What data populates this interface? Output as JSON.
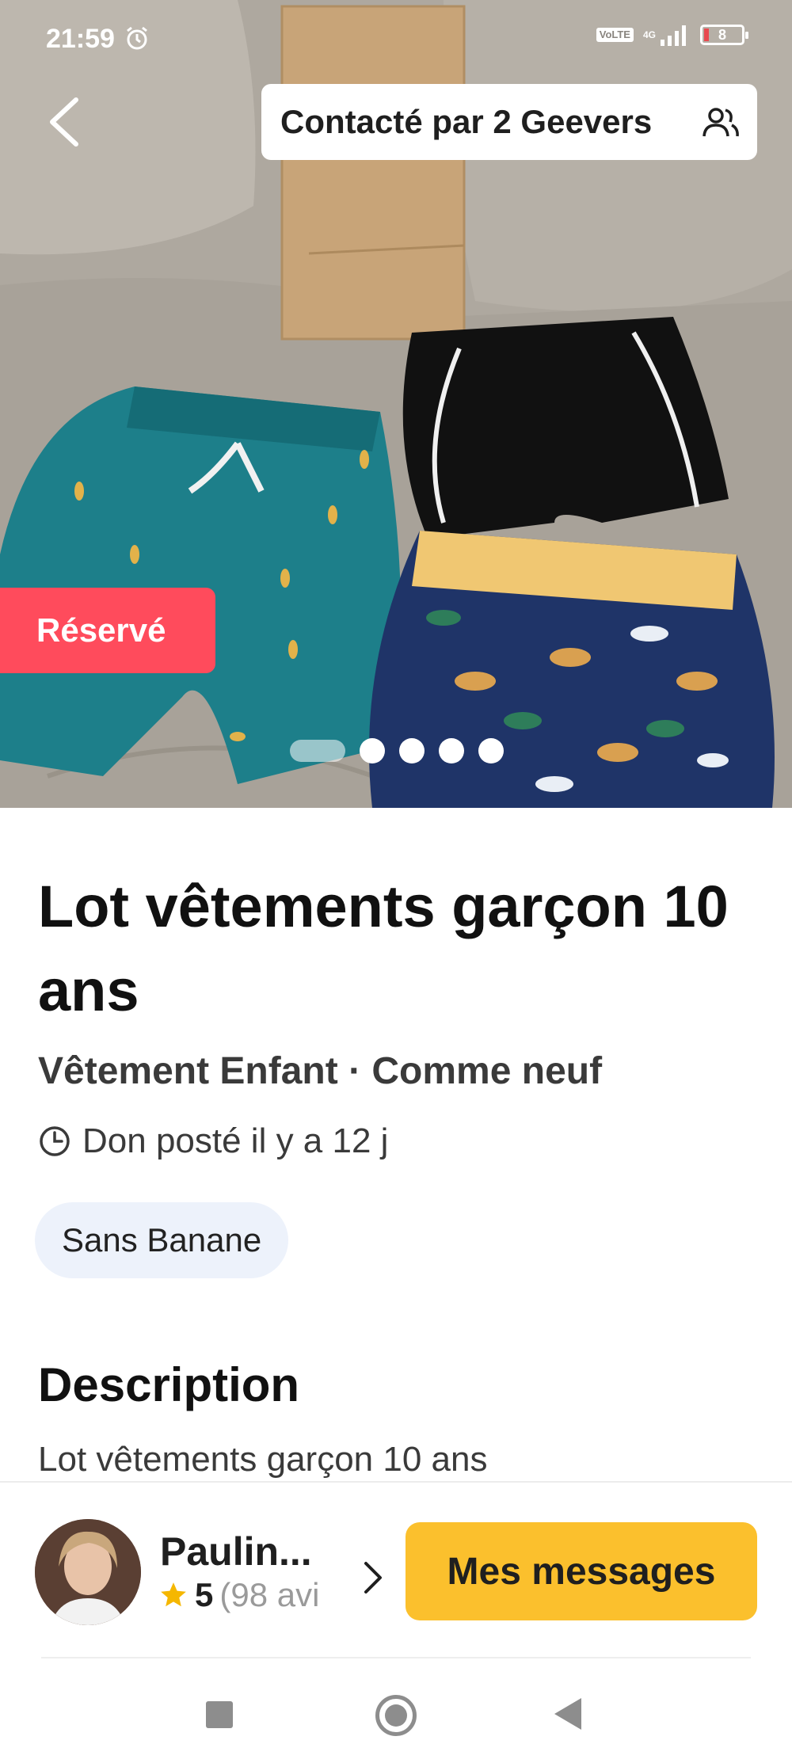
{
  "status_bar": {
    "time": "21:59",
    "alarm_icon": "alarm-icon",
    "network_badge": "VoLTE",
    "network_type": "4G",
    "battery_level": "8"
  },
  "header": {
    "back_icon": "chevron-left-icon",
    "contacted_label": "Contacté par 2 Geevers",
    "people_icon": "people-icon"
  },
  "photo": {
    "badge": "Réservé",
    "carousel": {
      "count": 5,
      "active_index": 0
    }
  },
  "listing": {
    "title": "Lot vêtements garçon 10 ans",
    "subtitle": "Vêtement Enfant · Comme neuf",
    "posted": "Don posté il y a 12 j",
    "tag": "Sans Banane",
    "description_heading": "Description",
    "description_text": "Lot vêtements garçon 10 ans"
  },
  "seller": {
    "name": "Paulin...",
    "rating": "5",
    "rating_count": "(98 avi"
  },
  "actions": {
    "messages_label": "Mes messages"
  },
  "colors": {
    "reserved_badge": "#ff4b5c",
    "primary_button": "#fbc02d",
    "tag_bg": "#edf2fb",
    "star": "#f5b700"
  }
}
